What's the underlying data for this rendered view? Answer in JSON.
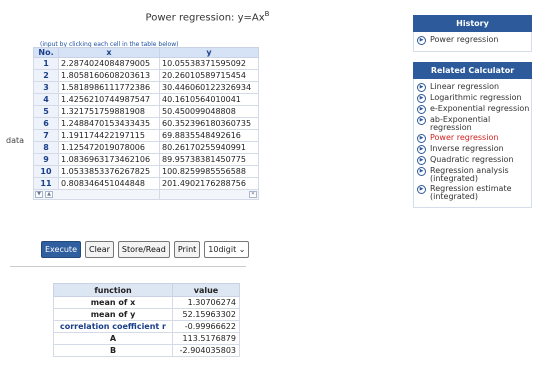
{
  "title": {
    "text": "Power regression: y=Ax",
    "sup": "B"
  },
  "input_hint": "(input by clicking each cell in the table below)",
  "data_label": "data",
  "table": {
    "headers": [
      "No.",
      "x",
      "y"
    ],
    "rows": [
      {
        "no": "1",
        "x": "2.2874024084879005",
        "y": "10.05538371595092"
      },
      {
        "no": "2",
        "x": "1.8058160608203613",
        "y": "20.26010589715454"
      },
      {
        "no": "3",
        "x": "1.5818986111772386",
        "y": "30.446060122326934"
      },
      {
        "no": "4",
        "x": "1.4256210744987547",
        "y": "40.1610564010041"
      },
      {
        "no": "5",
        "x": "1.321751759881908",
        "y": "50.450099048808"
      },
      {
        "no": "6",
        "x": "1.2488470153433435",
        "y": "60.352396180360735"
      },
      {
        "no": "7",
        "x": "1.191174422197115",
        "y": "69.8835548492616"
      },
      {
        "no": "8",
        "x": "1.125472019078006",
        "y": "80.26170255940991"
      },
      {
        "no": "9",
        "x": "1.0836963173462106",
        "y": "89.95738381450775"
      },
      {
        "no": "10",
        "x": "1.0533853376267825",
        "y": "100.8259985556588"
      },
      {
        "no": "11",
        "x": "0.808346451044848",
        "y": "201.4902176288756"
      }
    ]
  },
  "controls": {
    "execute": "Execute",
    "clear": "Clear",
    "store_read": "Store/Read",
    "print": "Print",
    "digits": "10digit"
  },
  "results": {
    "headers": [
      "function",
      "value"
    ],
    "rows": [
      {
        "fn": "mean of x",
        "value": "1.30706274"
      },
      {
        "fn": "mean of y",
        "value": "52.15963302"
      },
      {
        "fn": "correlation coefficient r",
        "value": "-0.99966622"
      },
      {
        "fn": "A",
        "value": "113.5176879"
      },
      {
        "fn": "B",
        "value": "-2.904035803"
      }
    ]
  },
  "history": {
    "title": "History",
    "items": [
      "Power regression"
    ]
  },
  "related": {
    "title": "Related Calculator",
    "items": [
      "Linear regression",
      "Logarithmic regression",
      "e-Exponential regression",
      "ab-Exponential regression",
      "Power regression",
      "Inverse regression",
      "Quadratic regression",
      "Regression analysis (integrated)",
      "Regression estimate (integrated)"
    ],
    "active_index": 4
  },
  "colors": {
    "accent": "#2d5a9a",
    "active_link": "#d21f1f"
  }
}
